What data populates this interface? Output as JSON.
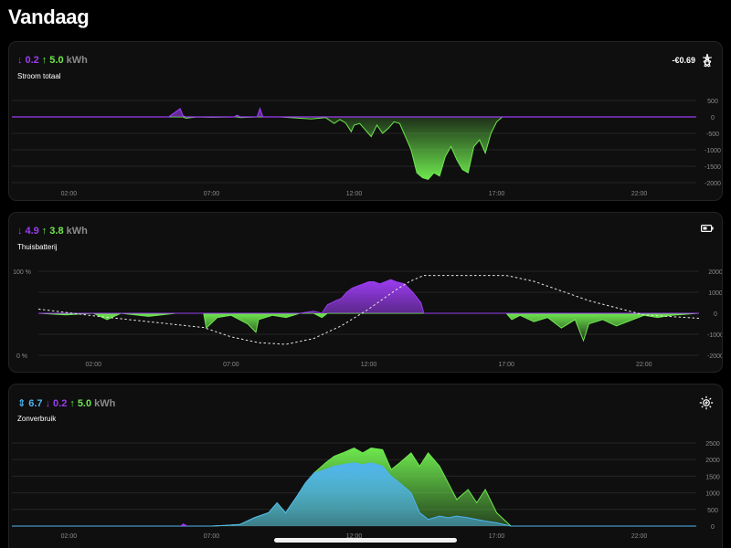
{
  "page": {
    "title": "Vandaag"
  },
  "colors": {
    "import": "#9b3cf0",
    "export": "#6ee84e",
    "self": "#4fb4ef",
    "grid": "#262626",
    "tick": "#8a8a8a"
  },
  "cards": {
    "grid": {
      "down_value": "0.2",
      "up_value": "5.0",
      "unit": "kWh",
      "subtitle": "Stroom totaal",
      "cost": "-€0.69",
      "icon": "transmission-tower-icon"
    },
    "battery": {
      "down_value": "4.9",
      "up_value": "3.8",
      "unit": "kWh",
      "subtitle": "Thuisbatterij",
      "icon": "battery-icon"
    },
    "solar": {
      "self_value": "6.7",
      "down_value": "0.2",
      "up_value": "5.0",
      "unit": "kWh",
      "subtitle": "Zonverbruik",
      "icon": "solar-sun-icon"
    }
  },
  "chart_data": [
    {
      "type": "area",
      "title": "Stroom totaal",
      "x_unit": "hour",
      "x_ticks": [
        "02:00",
        "07:00",
        "12:00",
        "17:00",
        "22:00"
      ],
      "x_tick_values": [
        2,
        7,
        12,
        17,
        22
      ],
      "xlim": [
        0,
        24
      ],
      "y_ticks": [
        "500",
        "0",
        "-500",
        "-1000",
        "-1500",
        "-2000"
      ],
      "ylim": [
        -2000,
        500
      ],
      "series": [
        {
          "x": [
            0,
            2,
            5.5,
            5.9,
            6,
            6.1,
            6.5,
            7,
            7.8,
            7.9,
            8,
            8.6,
            8.7,
            8.8,
            9.4,
            10.5,
            11,
            11.3,
            11.5,
            11.7,
            11.9,
            12,
            12.2,
            12.4,
            12.6,
            12.8,
            13,
            13.2,
            13.4,
            13.6,
            13.8,
            14,
            14.2,
            14.4,
            14.6,
            14.8,
            15,
            15.2,
            15.4,
            15.6,
            15.8,
            16,
            16.2,
            16.4,
            16.6,
            16.8,
            17,
            17.2,
            18,
            19,
            24
          ],
          "values": [
            0,
            0,
            0,
            250,
            30,
            -40,
            0,
            -10,
            0,
            50,
            -20,
            0,
            250,
            0,
            0,
            -60,
            -20,
            -200,
            -80,
            -180,
            -450,
            -250,
            -200,
            -400,
            -600,
            -250,
            -500,
            -350,
            -150,
            -200,
            -600,
            -1000,
            -1700,
            -1850,
            -1900,
            -1700,
            -1800,
            -1200,
            -900,
            -1300,
            -1600,
            -1700,
            -900,
            -700,
            -1100,
            -500,
            -150,
            0,
            0,
            0,
            0
          ]
        }
      ]
    },
    {
      "type": "area",
      "title": "Thuisbatterij",
      "x_unit": "hour",
      "x_ticks": [
        "02:00",
        "07:00",
        "12:00",
        "17:00",
        "22:00"
      ],
      "x_tick_values": [
        2,
        7,
        12,
        17,
        22
      ],
      "xlim": [
        0,
        24
      ],
      "y_ticks_right": [
        "2000",
        "1000",
        "0",
        "-1000",
        "-2000"
      ],
      "ylim": [
        -2000,
        2000
      ],
      "y_ticks_left": [
        "100 %",
        "0 %"
      ],
      "soc_lim": [
        0,
        100
      ],
      "series": [
        {
          "name": "charge-discharge",
          "x": [
            0,
            1,
            2,
            2.5,
            3,
            4,
            5,
            6,
            6.1,
            6.5,
            7,
            7.6,
            7.9,
            8,
            8.5,
            9,
            9.5,
            10,
            10.3,
            10.5,
            10.8,
            11,
            11.2,
            11.4,
            11.6,
            11.8,
            12,
            12.2,
            12.4,
            12.6,
            12.8,
            13,
            13.3,
            13.6,
            13.9,
            14,
            17,
            17.2,
            17.5,
            18,
            18.5,
            19,
            19.5,
            19.8,
            20,
            20.5,
            21,
            22,
            22.5,
            23,
            24
          ],
          "values": [
            0,
            -80,
            0,
            -300,
            0,
            -150,
            0,
            0,
            -700,
            -200,
            -100,
            -500,
            -900,
            -300,
            -100,
            -200,
            0,
            100,
            -200,
            400,
            600,
            700,
            1000,
            1200,
            1300,
            1400,
            1500,
            1500,
            1400,
            1500,
            1600,
            1500,
            1400,
            1000,
            500,
            0,
            0,
            -300,
            -100,
            -400,
            -200,
            -700,
            -300,
            -1300,
            -500,
            -300,
            -600,
            -100,
            -200,
            -100,
            0
          ]
        },
        {
          "name": "state-of-charge",
          "x": [
            0,
            2,
            4,
            6,
            7,
            8,
            9,
            10,
            11,
            12,
            13,
            13.5,
            14,
            16,
            17,
            18,
            20,
            22,
            24
          ],
          "soc": [
            55,
            47,
            40,
            33,
            22,
            15,
            13,
            20,
            35,
            55,
            78,
            88,
            95,
            95,
            95,
            88,
            65,
            48,
            44
          ]
        }
      ]
    },
    {
      "type": "area",
      "title": "Zonverbruik",
      "x_unit": "hour",
      "x_ticks": [
        "02:00",
        "07:00",
        "12:00",
        "17:00",
        "22:00"
      ],
      "x_tick_values": [
        2,
        7,
        12,
        17,
        22
      ],
      "xlim": [
        0,
        24
      ],
      "y_ticks": [
        "2500",
        "2000",
        "1500",
        "1000",
        "500",
        "0"
      ],
      "ylim": [
        0,
        2500
      ],
      "series": [
        {
          "name": "self-consumption",
          "x": [
            0,
            6,
            7,
            7.5,
            8,
            8.5,
            9,
            9.3,
            9.6,
            10,
            10.3,
            10.6,
            11,
            11.3,
            11.6,
            12,
            12.3,
            12.6,
            13,
            13.3,
            13.6,
            14,
            14.3,
            14.6,
            15,
            15.3,
            15.6,
            16,
            16.3,
            16.6,
            17,
            17.5,
            24
          ],
          "values": [
            0,
            0,
            0,
            20,
            50,
            250,
            400,
            700,
            400,
            900,
            1300,
            1600,
            1700,
            1800,
            1850,
            1900,
            1850,
            1900,
            1800,
            1500,
            1300,
            1000,
            400,
            200,
            300,
            250,
            300,
            250,
            200,
            150,
            100,
            0,
            0
          ]
        },
        {
          "name": "export",
          "x": [
            0,
            6,
            7,
            7.5,
            8,
            8.5,
            9,
            9.3,
            9.6,
            10,
            10.3,
            10.6,
            11,
            11.3,
            11.6,
            12,
            12.3,
            12.6,
            13,
            13.3,
            13.6,
            14,
            14.3,
            14.6,
            15,
            15.3,
            15.6,
            16,
            16.3,
            16.6,
            17,
            17.5,
            24
          ],
          "values": [
            0,
            0,
            0,
            20,
            50,
            250,
            400,
            700,
            400,
            900,
            1300,
            1600,
            1900,
            2100,
            2200,
            2350,
            2200,
            2350,
            2300,
            1700,
            1900,
            2200,
            1800,
            2200,
            1800,
            1300,
            800,
            1100,
            700,
            1100,
            400,
            0,
            0
          ]
        },
        {
          "name": "import",
          "x": [
            5.9,
            6,
            6.2
          ],
          "values": [
            0,
            80,
            0
          ]
        }
      ]
    }
  ]
}
